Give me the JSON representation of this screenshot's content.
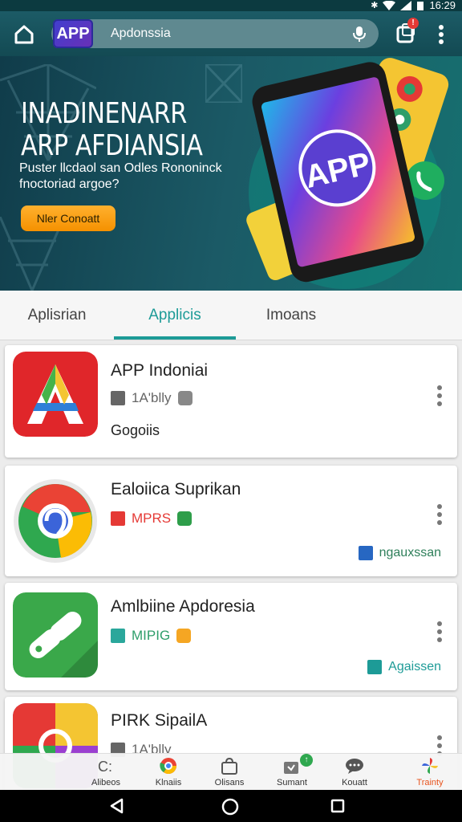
{
  "status_bar": {
    "time": "16:29"
  },
  "header": {
    "app_badge": "APP",
    "search_text": "Apdonssia",
    "notification_badge": "!"
  },
  "banner": {
    "title_line1": "INADINENARR",
    "title_line2": "ARP AFDIANSIA",
    "subtitle": "Puster llcdaol san Odles Rononinck fnoctoriad argoe?",
    "cta_label": "Nler Conoatt",
    "phone_logo": "APP"
  },
  "tabs": [
    {
      "label": "Aplisrian",
      "active": false
    },
    {
      "label": "Applicis",
      "active": true
    },
    {
      "label": "Imoans",
      "active": false
    }
  ],
  "apps": [
    {
      "title": "APP Indoniai",
      "meta": "1A'blly",
      "meta_color": "#666666",
      "sub": "Gogoiis",
      "right_tag": ""
    },
    {
      "title": "Ealoiica Suprikan",
      "meta": "MPRS",
      "meta_color": "#e53935",
      "sub": "",
      "right_tag": "ngauxssan"
    },
    {
      "title": "Amlbiine Apdoresia",
      "meta": "MIPIG",
      "meta_color": "#2e9e6a",
      "sub": "",
      "right_tag": "Agaissen"
    },
    {
      "title": "PIRK SipailA",
      "meta": "1A'blly",
      "meta_color": "#666666",
      "sub": "",
      "right_tag": ""
    }
  ],
  "bottom_nav": [
    {
      "label": "Alibeos",
      "icon": "grid-icon",
      "active": false
    },
    {
      "label": "Klnaiis",
      "icon": "chrome-icon",
      "active": false
    },
    {
      "label": "Olisans",
      "icon": "bag-icon",
      "active": false
    },
    {
      "label": "Sumant",
      "icon": "download-icon",
      "active": false,
      "badge": "↑"
    },
    {
      "label": "Kouatt",
      "icon": "chat-icon",
      "active": false
    },
    {
      "label": "Trainty",
      "icon": "pinwheel-icon",
      "active": true
    }
  ],
  "colors": {
    "accent": "#1d9b97",
    "header": "#1c5b66",
    "cta": "#f59100",
    "active_nav": "#e8551f"
  }
}
